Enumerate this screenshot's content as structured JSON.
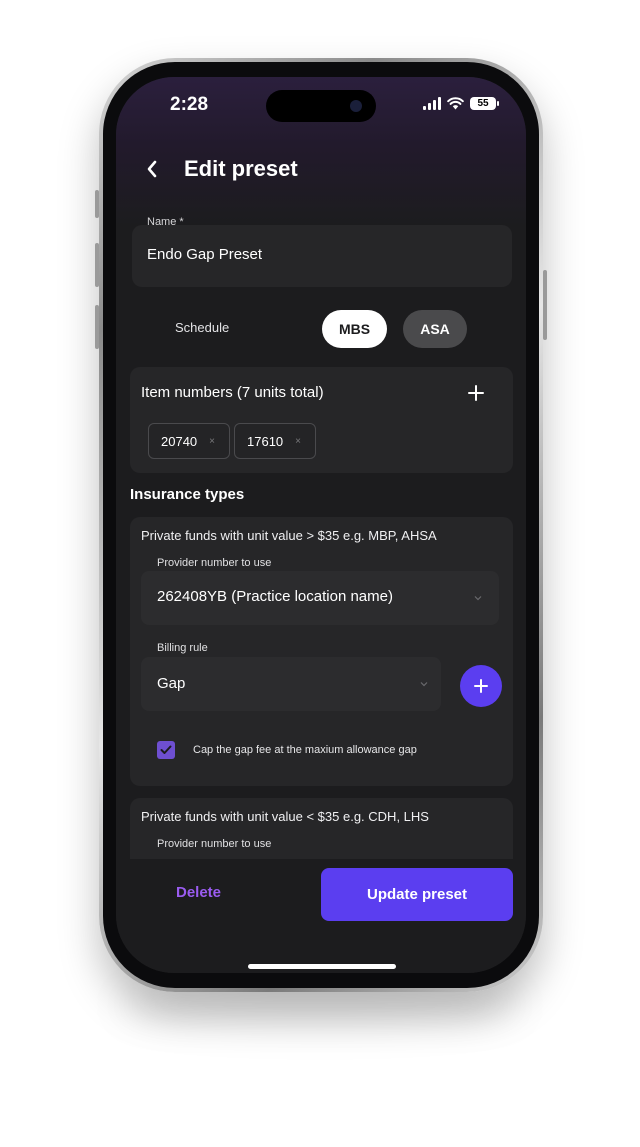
{
  "status_bar": {
    "time": "2:28",
    "battery": "55"
  },
  "header": {
    "title": "Edit preset"
  },
  "name_field": {
    "label": "Name *",
    "value": "Endo Gap Preset"
  },
  "schedule": {
    "label": "Schedule",
    "options": [
      "MBS",
      "ASA"
    ],
    "selected": "MBS"
  },
  "item_numbers": {
    "title": "Item numbers (7 units total)",
    "items": [
      {
        "code": "20740",
        "remove": "×"
      },
      {
        "code": "17610",
        "remove": "×"
      }
    ]
  },
  "insurance": {
    "section_title": "Insurance types",
    "types": [
      {
        "title": "Private funds with unit value > $35 e.g. MBP, AHSA",
        "provider_label": "Provider number to use",
        "provider_value": "262408YB (Practice location name)",
        "billing_label": "Billing rule",
        "billing_value": "Gap",
        "cap_checked": true,
        "cap_label": "Cap the gap fee at the maxium allowance gap"
      },
      {
        "title": "Private funds with unit value < $35 e.g. CDH, LHS",
        "provider_label": "Provider number to use"
      }
    ]
  },
  "footer": {
    "delete_label": "Delete",
    "update_label": "Update preset"
  },
  "colors": {
    "accent": "#5b3ef0",
    "delete": "#9a5cf0",
    "background": "#1c1c1e",
    "card": "#262628",
    "checkbox": "#6e4fd1"
  }
}
